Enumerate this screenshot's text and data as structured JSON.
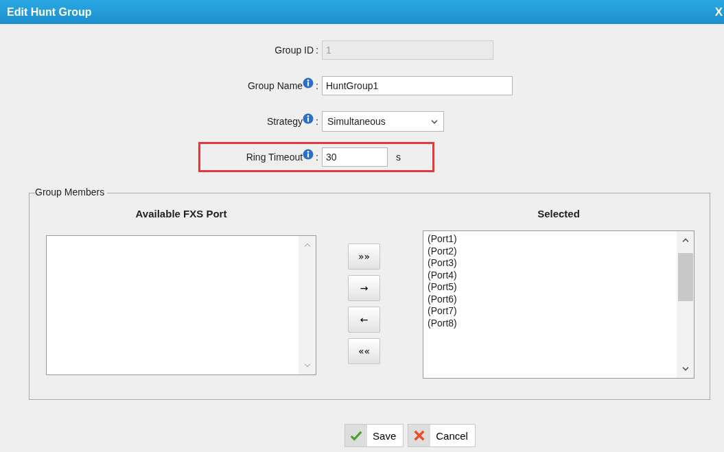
{
  "dialog": {
    "title": "Edit Hunt Group",
    "close": "X"
  },
  "fields": [
    {
      "kind": "text",
      "label": "Group ID",
      "separator": ":",
      "value": "1",
      "disabled": true,
      "info": false,
      "highlighted": false
    },
    {
      "kind": "text",
      "label": "Group Name",
      "separator": ":",
      "value": "HuntGroup1",
      "disabled": false,
      "info": true,
      "highlighted": false
    },
    {
      "kind": "select",
      "label": "Strategy",
      "separator": ":",
      "value": "Simultaneous",
      "disabled": false,
      "info": true,
      "highlighted": false
    },
    {
      "kind": "unit",
      "label": "Ring Timeout",
      "separator": ":",
      "value": "30",
      "unit": "s",
      "disabled": false,
      "info": true,
      "highlighted": true
    }
  ],
  "members": {
    "legend": "Group Members",
    "available_heading": "Available FXS Port",
    "selected_heading": "Selected",
    "selected": [
      "(Port1)",
      "(Port2)",
      "(Port3)",
      "(Port4)",
      "(Port5)",
      "(Port6)",
      "(Port7)",
      "(Port8)"
    ],
    "move_buttons": [
      "»»",
      "→",
      "←",
      "««"
    ]
  },
  "buttons": [
    {
      "kind": "save",
      "label": "Save"
    },
    {
      "kind": "cancel",
      "label": "Cancel"
    }
  ]
}
